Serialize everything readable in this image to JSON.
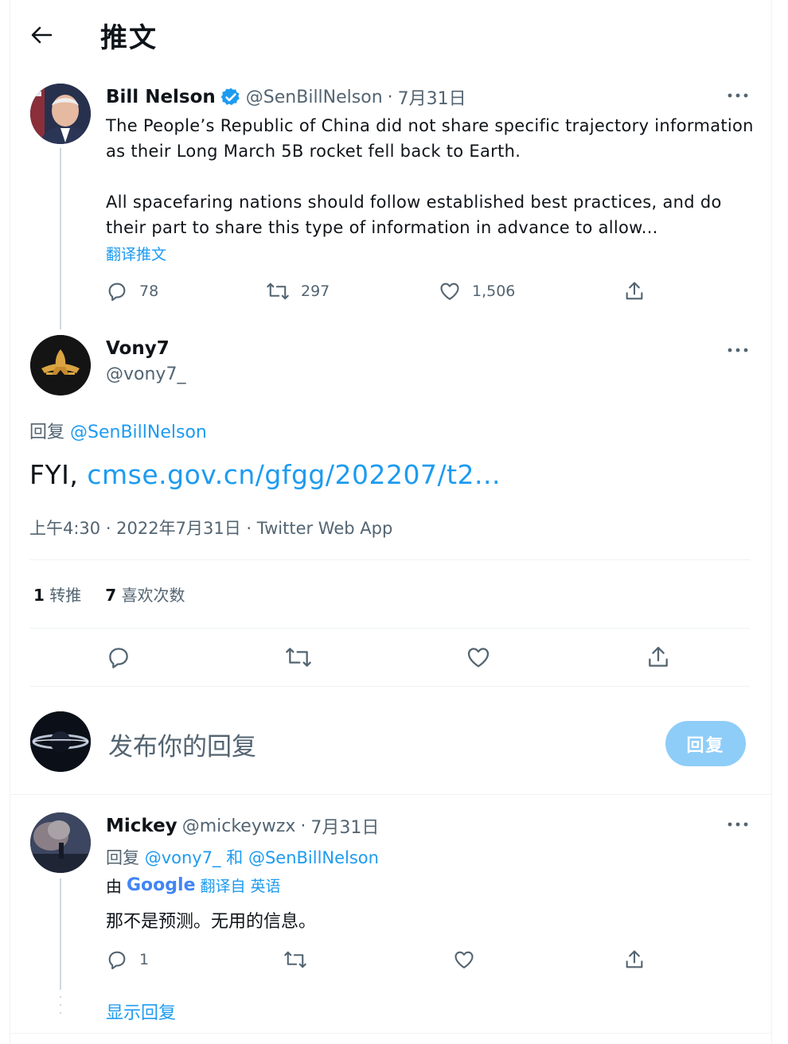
{
  "header": {
    "title": "推文"
  },
  "tweet1": {
    "name": "Bill Nelson",
    "handle": "@SenBillNelson",
    "sep": "·",
    "date": "7月31日",
    "line1": "The People’s Republic of China did not share specific trajectory information",
    "line2": "as their Long March 5B rocket fell back to Earth.",
    "line3": "All spacefaring nations should follow established best practices, and do",
    "line4": "their part to share this type of information in advance to allow...",
    "translate": "翻译推文",
    "replies": "78",
    "retweets": "297",
    "likes": "1,506"
  },
  "main_tweet": {
    "name": "Vony7",
    "handle": "@vony7_",
    "reply_prefix": "回复",
    "reply_to": "@SenBillNelson",
    "text_prefix": "FYI,",
    "link": "cmse.gov.cn/gfgg/202207/t2...",
    "timestamp": "上午4:30 · 2022年7月31日 · Twitter Web App",
    "retweet_count": "1",
    "retweet_label": "转推",
    "like_count": "7",
    "like_label": "喜欢次数"
  },
  "compose": {
    "placeholder": "发布你的回复",
    "button": "回复"
  },
  "reply1": {
    "name": "Mickey",
    "handle": "@mickeywzx",
    "sep": "·",
    "date": "7月31日",
    "reply_prefix": "回复",
    "reply_to1": "@vony7_",
    "and": "和",
    "reply_to2": "@SenBillNelson",
    "by": "由",
    "google": "Google",
    "translated_from": "翻译自 英语",
    "text": "那不是预测。无用的信息。",
    "replies": "1",
    "show_replies": "显示回复"
  },
  "colors": {
    "accent": "#1d9bf0",
    "muted": "#536471",
    "reply_button": "#8ecdf8",
    "verified": "#1d9bf0"
  },
  "icons": [
    "back-arrow-icon",
    "verified-badge-icon",
    "more-icon",
    "reply-icon",
    "retweet-icon",
    "like-icon",
    "share-icon"
  ]
}
